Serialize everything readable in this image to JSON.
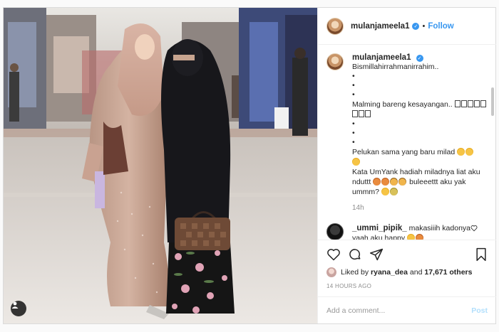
{
  "post": {
    "username": "mulanjameela1",
    "follow_label": "Follow",
    "separator": "•",
    "verified_mark": "✓",
    "caption": {
      "line1": "Bismillahirrahmanirrahim..",
      "bullets": [
        "•",
        "•",
        "•"
      ],
      "line2": "Malming bareng kesayangan..",
      "line2_tail": "",
      "bullets2": [
        "•",
        "•",
        "•"
      ],
      "line3": "Pelukan sama yang baru milad",
      "line4": "Kata UmYank hadiah miladnya liat aku nduttt",
      "line4_tail": "buleeettt aku yak ummm?"
    },
    "caption_age": "14h",
    "comment": {
      "username": "_ummi_pipik_",
      "text": "makasiiih kadonya yaah aku happy"
    },
    "likes": {
      "prefix": "Liked by ",
      "user": "ryana_dea",
      "middle": " and ",
      "count": "17,671 others"
    },
    "posted_ago": "14 HOURS AGO",
    "add_comment_placeholder": "Add a comment...",
    "post_label": "Post"
  },
  "icons": {
    "heart": "heart-icon",
    "comment": "comment-icon",
    "share": "share-icon",
    "save": "bookmark-icon",
    "tag": "person-tag-icon"
  },
  "colors": {
    "accent": "#3897f0",
    "verified": "#3897f0",
    "post_disabled": "#b2dffc",
    "muted": "#8e8e8e"
  }
}
